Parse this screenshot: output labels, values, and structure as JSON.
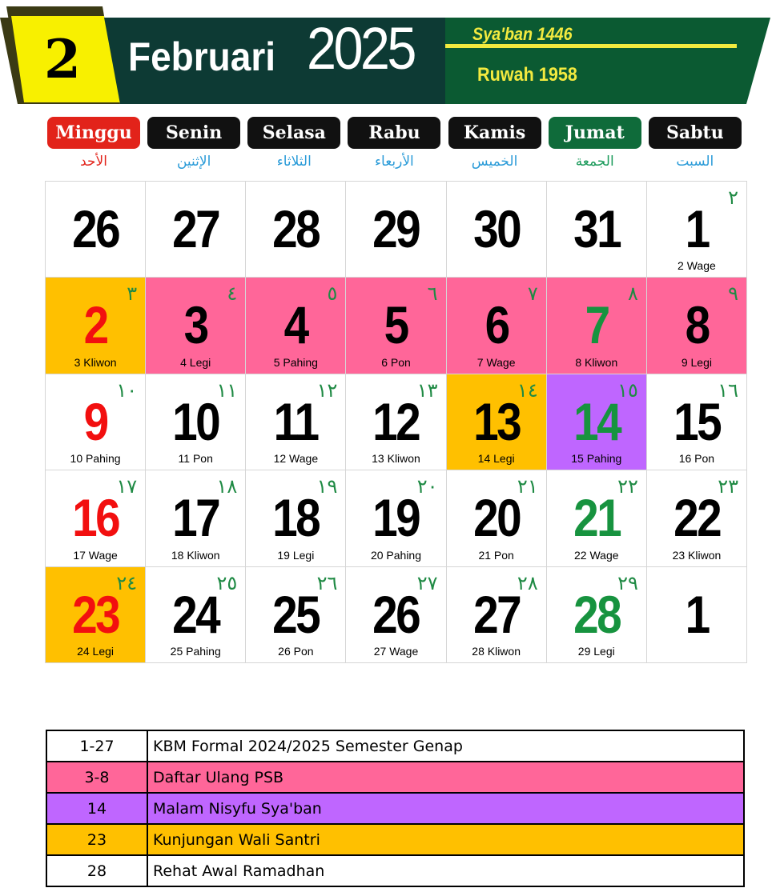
{
  "header": {
    "month_number": "2",
    "month_name": "Februari",
    "year": "2025",
    "hijri": "Sya'ban 1446",
    "javanese": "Ruwah 1958",
    "colors": {
      "yellow": "#f8f000",
      "dark_teal": "#0d3a34",
      "green": "#0b5a32",
      "text_yellow": "#f3ea3f"
    }
  },
  "days": [
    {
      "name": "Minggu",
      "arabic": "الأحد",
      "bg": "#e2231a",
      "arabic_color": "#e2231a"
    },
    {
      "name": "Senin",
      "arabic": "الإثنين",
      "bg": "#111111",
      "arabic_color": "#2a9bd8"
    },
    {
      "name": "Selasa",
      "arabic": "الثلاثاء",
      "bg": "#111111",
      "arabic_color": "#2a9bd8"
    },
    {
      "name": "Rabu",
      "arabic": "الأربعاء",
      "bg": "#111111",
      "arabic_color": "#2a9bd8"
    },
    {
      "name": "Kamis",
      "arabic": "الخميس",
      "bg": "#111111",
      "arabic_color": "#2a9bd8"
    },
    {
      "name": "Jumat",
      "arabic": "الجمعة",
      "bg": "#0f6b3a",
      "arabic_color": "#1a9a5a"
    },
    {
      "name": "Sabtu",
      "arabic": "السبت",
      "bg": "#111111",
      "arabic_color": "#2a9bd8"
    }
  ],
  "weeks": [
    [
      {
        "d": "26",
        "h": "",
        "p": "",
        "c": "#000000",
        "bg": ""
      },
      {
        "d": "27",
        "h": "",
        "p": "",
        "c": "#000000",
        "bg": ""
      },
      {
        "d": "28",
        "h": "",
        "p": "",
        "c": "#000000",
        "bg": ""
      },
      {
        "d": "29",
        "h": "",
        "p": "",
        "c": "#000000",
        "bg": ""
      },
      {
        "d": "30",
        "h": "",
        "p": "",
        "c": "#000000",
        "bg": ""
      },
      {
        "d": "31",
        "h": "",
        "p": "",
        "c": "#000000",
        "bg": ""
      },
      {
        "d": "1",
        "h": "٢",
        "p": "2 Wage",
        "c": "#000000",
        "bg": ""
      }
    ],
    [
      {
        "d": "2",
        "h": "٣",
        "p": "3 Kliwon",
        "c": "#f20f0f",
        "bg": "#ffc000"
      },
      {
        "d": "3",
        "h": "٤",
        "p": "4 Legi",
        "c": "#000000",
        "bg": "#ff6699"
      },
      {
        "d": "4",
        "h": "٥",
        "p": "5 Pahing",
        "c": "#000000",
        "bg": "#ff6699"
      },
      {
        "d": "5",
        "h": "٦",
        "p": "6 Pon",
        "c": "#000000",
        "bg": "#ff6699"
      },
      {
        "d": "6",
        "h": "٧",
        "p": "7 Wage",
        "c": "#000000",
        "bg": "#ff6699"
      },
      {
        "d": "7",
        "h": "٨",
        "p": "8 Kliwon",
        "c": "#17933f",
        "bg": "#ff6699"
      },
      {
        "d": "8",
        "h": "٩",
        "p": "9 Legi",
        "c": "#000000",
        "bg": "#ff6699"
      }
    ],
    [
      {
        "d": "9",
        "h": "١٠",
        "p": "10 Pahing",
        "c": "#f20f0f",
        "bg": ""
      },
      {
        "d": "10",
        "h": "١١",
        "p": "11 Pon",
        "c": "#000000",
        "bg": ""
      },
      {
        "d": "11",
        "h": "١٢",
        "p": "12 Wage",
        "c": "#000000",
        "bg": ""
      },
      {
        "d": "12",
        "h": "١٣",
        "p": "13 Kliwon",
        "c": "#000000",
        "bg": ""
      },
      {
        "d": "13",
        "h": "١٤",
        "p": "14 Legi",
        "c": "#000000",
        "bg": "#ffc000"
      },
      {
        "d": "14",
        "h": "١٥",
        "p": "15 Pahing",
        "c": "#17933f",
        "bg": "#bf66ff"
      },
      {
        "d": "15",
        "h": "١٦",
        "p": "16 Pon",
        "c": "#000000",
        "bg": ""
      }
    ],
    [
      {
        "d": "16",
        "h": "١٧",
        "p": "17 Wage",
        "c": "#f20f0f",
        "bg": ""
      },
      {
        "d": "17",
        "h": "١٨",
        "p": "18 Kliwon",
        "c": "#000000",
        "bg": ""
      },
      {
        "d": "18",
        "h": "١٩",
        "p": "19 Legi",
        "c": "#000000",
        "bg": ""
      },
      {
        "d": "19",
        "h": "٢٠",
        "p": "20 Pahing",
        "c": "#000000",
        "bg": ""
      },
      {
        "d": "20",
        "h": "٢١",
        "p": "21 Pon",
        "c": "#000000",
        "bg": ""
      },
      {
        "d": "21",
        "h": "٢٢",
        "p": "22 Wage",
        "c": "#17933f",
        "bg": ""
      },
      {
        "d": "22",
        "h": "٢٣",
        "p": "23 Kliwon",
        "c": "#000000",
        "bg": ""
      }
    ],
    [
      {
        "d": "23",
        "h": "٢٤",
        "p": "24 Legi",
        "c": "#f20f0f",
        "bg": "#ffc000"
      },
      {
        "d": "24",
        "h": "٢٥",
        "p": "25 Pahing",
        "c": "#000000",
        "bg": ""
      },
      {
        "d": "25",
        "h": "٢٦",
        "p": "26 Pon",
        "c": "#000000",
        "bg": ""
      },
      {
        "d": "26",
        "h": "٢٧",
        "p": "27 Wage",
        "c": "#000000",
        "bg": ""
      },
      {
        "d": "27",
        "h": "٢٨",
        "p": "28 Kliwon",
        "c": "#000000",
        "bg": ""
      },
      {
        "d": "28",
        "h": "٢٩",
        "p": "29 Legi",
        "c": "#17933f",
        "bg": ""
      },
      {
        "d": "1",
        "h": "",
        "p": "",
        "c": "#000000",
        "bg": ""
      }
    ]
  ],
  "legend": [
    {
      "dates": "1-27",
      "text": "KBM Formal 2024/2025 Semester Genap",
      "bg": "#ffffff"
    },
    {
      "dates": "3-8",
      "text": "Daftar Ulang PSB",
      "bg": "#ff6699"
    },
    {
      "dates": "14",
      "text": "Malam Nisyfu Sya'ban",
      "bg": "#bf66ff"
    },
    {
      "dates": "23",
      "text": "Kunjungan Wali Santri",
      "bg": "#ffc000"
    },
    {
      "dates": "28",
      "text": "Rehat Awal Ramadhan",
      "bg": "#ffffff"
    }
  ]
}
